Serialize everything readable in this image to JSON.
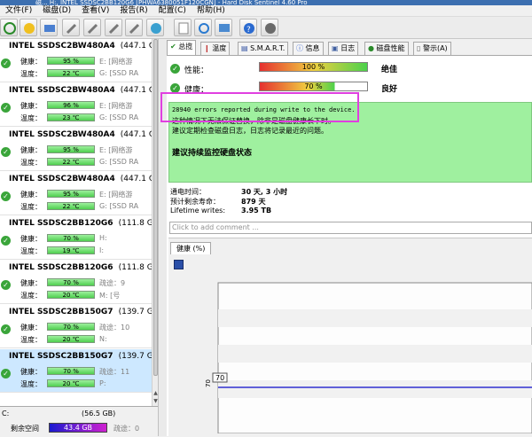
{
  "title_text": "磁... H:, INTEL SSDSC2BB120G6 [PHWA6380051F120CGN] - Hard Disk Sentinel 4.60 Pro",
  "menu": [
    "文件(F)",
    "磁盘(D)",
    "查看(V)",
    "报告(R)",
    "配置(C)",
    "帮助(H)"
  ],
  "disks": [
    {
      "name": "INTEL SSDSC2BW480A4",
      "cap": "(447.1 GB)",
      "health": "95 %",
      "temp": "22 ℃",
      "r1": "E: [网络游",
      "r2": "G: [SSD RA",
      "status": "ok",
      "health_label": "健康：",
      "temp_label": "温度："
    },
    {
      "name": "INTEL SSDSC2BW480A4",
      "cap": "(447.1 GB)",
      "health": "96 %",
      "temp": "23 ℃",
      "r1": "E: [网络游",
      "r2": "G: [SSD RA",
      "status": "ok",
      "health_label": "健康：",
      "temp_label": "温度："
    },
    {
      "name": "INTEL SSDSC2BW480A4",
      "cap": "(447.1 GB)",
      "health": "95 %",
      "temp": "22 ℃",
      "r1": "E: [网络游",
      "r2": "G: [SSD RA",
      "status": "ok",
      "health_label": "健康：",
      "temp_label": "温度："
    },
    {
      "name": "INTEL SSDSC2BW480A4",
      "cap": "(447.1 GB)",
      "health": "95 %",
      "temp": "22 ℃",
      "r1": "E: [网络游",
      "r2": "G: [SSD RA",
      "status": "ok",
      "health_label": "健康：",
      "temp_label": "温度："
    },
    {
      "name": "INTEL SSDSC2BB120G6",
      "cap": "(111.8 GB)",
      "health": "70 %",
      "temp": "19 ℃",
      "r1": "H:",
      "r2": "I:",
      "status": "ok",
      "health_label": "健康：",
      "temp_label": "温度："
    },
    {
      "name": "INTEL SSDSC2BB120G6",
      "cap": "(111.8 GB)",
      "health": "70 %",
      "temp": "20 ℃",
      "r1": "疏途：9",
      "r2": "M: [号",
      "status": "ok",
      "health_label": "健康：",
      "temp_label": "温度："
    },
    {
      "name": "INTEL SSDSC2BB150G7",
      "cap": "(139.7 GB)",
      "health": "70 %",
      "temp": "20 ℃",
      "r1": "疏途：10",
      "r2": "N:",
      "status": "ok",
      "health_label": "健康：",
      "temp_label": "温度："
    },
    {
      "name": "INTEL SSDSC2BB150G7",
      "cap": "(139.7 GB)",
      "health": "70 %",
      "temp": "20 ℃",
      "r1": "疏途：11",
      "r2": "P:",
      "status": "ok",
      "health_label": "健康：",
      "temp_label": "温度："
    }
  ],
  "drive": {
    "letter": "C:",
    "size": "(56.5 GB)",
    "free_label": "剩余空间",
    "free": "43.4 GB",
    "extra": "疏途：0"
  },
  "tabs": [
    "总揽",
    "温度",
    "S.M.A.R.T.",
    "信息",
    "日志",
    "磁盘性能",
    "警示(A)"
  ],
  "perf_label": "性能：",
  "perf_value": "100 %",
  "perf_word": "绝佳",
  "health_label": "健康：",
  "health_value": "70 %",
  "health_word": "良好",
  "msg1": "28940 errors reported during write to the device.",
  "msg2": "这种情况下无法保证替换，除非是磁盘健康长下时。",
  "msg3": "建议定期检查磁盘日志，日志将记录最近的问题。",
  "msg4": "建议持续监控硬盘状态",
  "stats": [
    {
      "label": "通电时间：",
      "value": "30 天, 3 小时"
    },
    {
      "label": "预计剩余寿命：",
      "value": "879 天"
    },
    {
      "label": "Lifetime writes:",
      "value": "3.95 TB"
    }
  ],
  "comment_placeholder": "Click to add comment ...",
  "chart_tab": "健康 (%)",
  "chart_data": {
    "type": "line",
    "series": [
      {
        "values": [
          70,
          70
        ]
      }
    ],
    "y_tick": "70",
    "point_label": "70",
    "title": "",
    "xlabel": "",
    "ylabel": ""
  }
}
